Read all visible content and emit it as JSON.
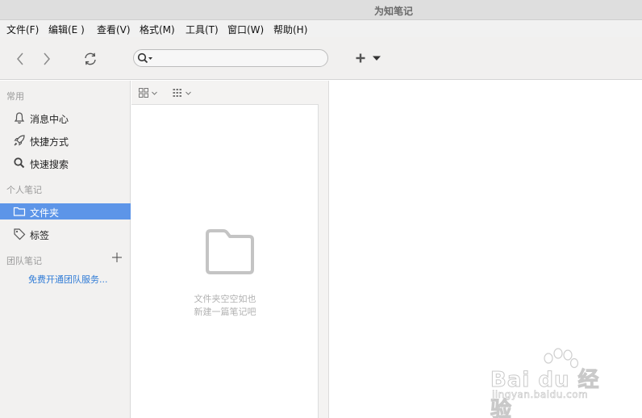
{
  "window": {
    "title": "为知笔记"
  },
  "menu": [
    {
      "label": "文件(F)"
    },
    {
      "label": "编辑(E )"
    },
    {
      "label": "查看(V)"
    },
    {
      "label": "格式(M)"
    },
    {
      "label": "工具(T)"
    },
    {
      "label": "窗口(W)"
    },
    {
      "label": "帮助(H)"
    }
  ],
  "search": {
    "value": "",
    "placeholder": ""
  },
  "sidebar": {
    "sections": {
      "common": "常用",
      "personal": "个人笔记",
      "team": "团队笔记"
    },
    "common_items": [
      {
        "label": "消息中心",
        "icon": "bell-icon"
      },
      {
        "label": "快捷方式",
        "icon": "rocket-icon"
      },
      {
        "label": "快速搜索",
        "icon": "search-icon"
      }
    ],
    "personal_items": [
      {
        "label": "文件夹",
        "icon": "folder-icon",
        "selected": true
      },
      {
        "label": "标签",
        "icon": "tag-icon",
        "selected": false
      }
    ],
    "team_link": "免费开通团队服务..."
  },
  "list": {
    "empty_line1": "文件夹空空如也",
    "empty_line2": "新建一篇笔记吧"
  },
  "watermark": {
    "main": "Bai du 经验",
    "sub": "jingyan.baidu.com"
  },
  "colors": {
    "selection": "#5d95e8",
    "link": "#2f7bd6"
  }
}
